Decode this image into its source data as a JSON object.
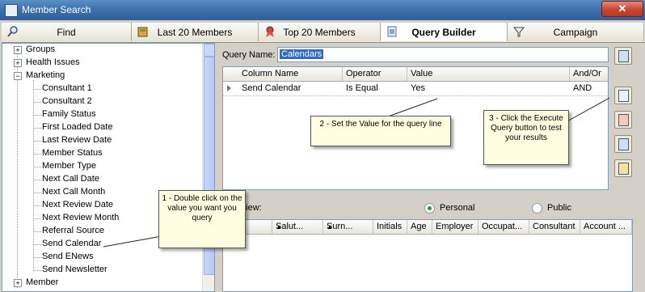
{
  "window": {
    "title": "Member Search",
    "close_glyph": "✕"
  },
  "tabs": [
    {
      "label": "Find",
      "icon": "search-icon"
    },
    {
      "label": "Last 20 Members",
      "icon": "book-icon"
    },
    {
      "label": "Top 20 Members",
      "icon": "ribbon-icon"
    },
    {
      "label": "Query Builder",
      "icon": "query-icon",
      "active": true
    },
    {
      "label": "Campaign",
      "icon": "funnel-icon"
    }
  ],
  "tree": [
    {
      "label": "Groups",
      "expander": "+"
    },
    {
      "label": "Health Issues",
      "expander": "+"
    },
    {
      "label": "Marketing",
      "expander": "−"
    },
    {
      "label": "Consultant 1"
    },
    {
      "label": "Consultant 2"
    },
    {
      "label": "Family Status"
    },
    {
      "label": "First Loaded Date"
    },
    {
      "label": "Last Review Date"
    },
    {
      "label": "Member Status"
    },
    {
      "label": "Member Type"
    },
    {
      "label": "Next Call Date"
    },
    {
      "label": "Next Call Month"
    },
    {
      "label": "Next Review Date"
    },
    {
      "label": "Next Review Month"
    },
    {
      "label": "Referral Source"
    },
    {
      "label": "Send Calendar"
    },
    {
      "label": "Send ENews"
    },
    {
      "label": "Send Newsletter"
    },
    {
      "label": "Member",
      "expander": "+"
    }
  ],
  "query": {
    "name_label": "Query Name:",
    "name_value": "Calendars",
    "dropdown_glyph": "▼",
    "columns": [
      "Column Name",
      "Operator",
      "Value",
      "And/Or"
    ],
    "rows": [
      [
        "Send Calendar",
        "Is Equal",
        "Yes",
        "AND"
      ]
    ]
  },
  "view": {
    "label": "View:",
    "options": [
      "Personal",
      "Public"
    ],
    "selected": "Personal"
  },
  "results": {
    "columns": [
      "Salut...",
      "Surn...",
      "Initials",
      "Age",
      "Employer",
      "Occupat...",
      "Consultant",
      "Account ..."
    ]
  },
  "callouts": {
    "one": "1 - Double click on the value you want you query",
    "two": "2 - Set the Value for the query line",
    "three": "3 - Click the Execute Query button to test your results"
  },
  "colors": {
    "selection": "#316ac5",
    "callout_bg": "#fffee0",
    "title_bar": "#3f72ad"
  }
}
